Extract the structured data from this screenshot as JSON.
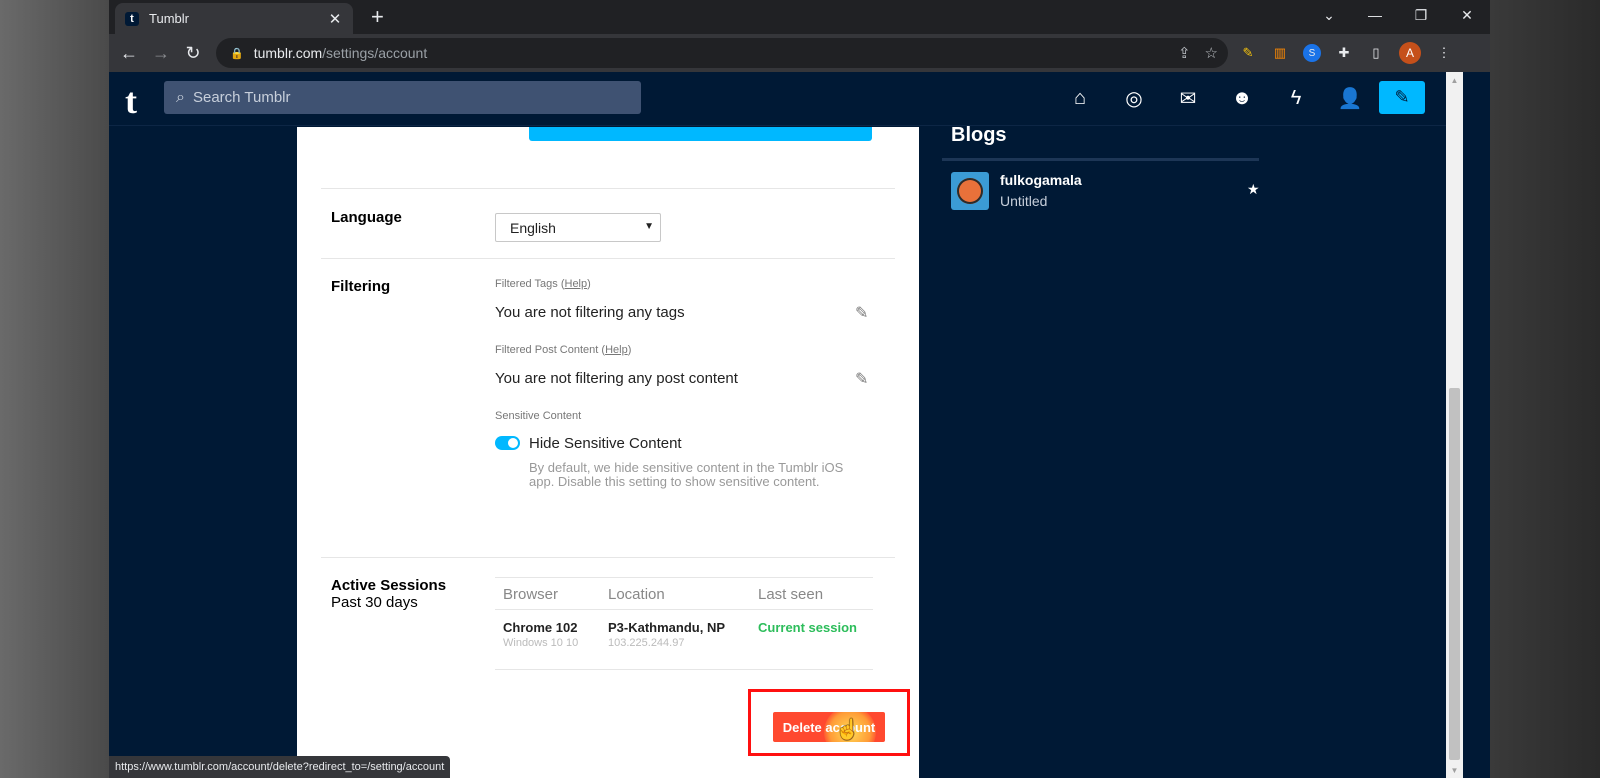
{
  "browser": {
    "tab_title": "Tumblr",
    "tab_favicon": "t",
    "url_host": "tumblr.com",
    "url_path": "/settings/account",
    "profile_initial": "A",
    "status_url": "https://www.tumblr.com/account/delete?redirect_to=/setting/account"
  },
  "header": {
    "search_placeholder": "Search Tumblr",
    "logo": "t"
  },
  "settings": {
    "language_label": "Language",
    "language_value": "English",
    "filtering_label": "Filtering",
    "filtered_tags_label": "Filtered Tags (",
    "filtered_tags_help": "Help",
    "filtered_tags_close": ")",
    "filtered_tags_text": "You are not filtering any tags",
    "filtered_post_label": "Filtered Post Content (",
    "filtered_post_help": "Help",
    "filtered_post_close": ")",
    "filtered_post_text": "You are not filtering any post content",
    "sensitive_label": "Sensitive Content",
    "sensitive_toggle_label": "Hide Sensitive Content",
    "sensitive_toggle_on": true,
    "sensitive_desc": "By default, we hide sensitive content in the Tumblr iOS app. Disable this setting to show sensitive content."
  },
  "sessions": {
    "title": "Active Sessions",
    "subtitle": "Past 30 days",
    "columns": [
      "Browser",
      "Location",
      "Last seen"
    ],
    "rows": [
      {
        "browser": "Chrome 102",
        "os": "Windows 10 10",
        "location": "P3-Kathmandu, NP",
        "ip": "103.225.244.97",
        "last_seen": "Current session"
      }
    ]
  },
  "delete_button": "Delete account",
  "blogs": {
    "title": "Blogs",
    "items": [
      {
        "name": "fulkogamala",
        "subtitle": "Untitled"
      }
    ]
  },
  "colors": {
    "tumblr_navy": "#001935",
    "accent_blue": "#00b8ff",
    "delete_red": "#ff492f",
    "session_green": "#2dbd5b",
    "annotation_red": "#ff1010"
  }
}
